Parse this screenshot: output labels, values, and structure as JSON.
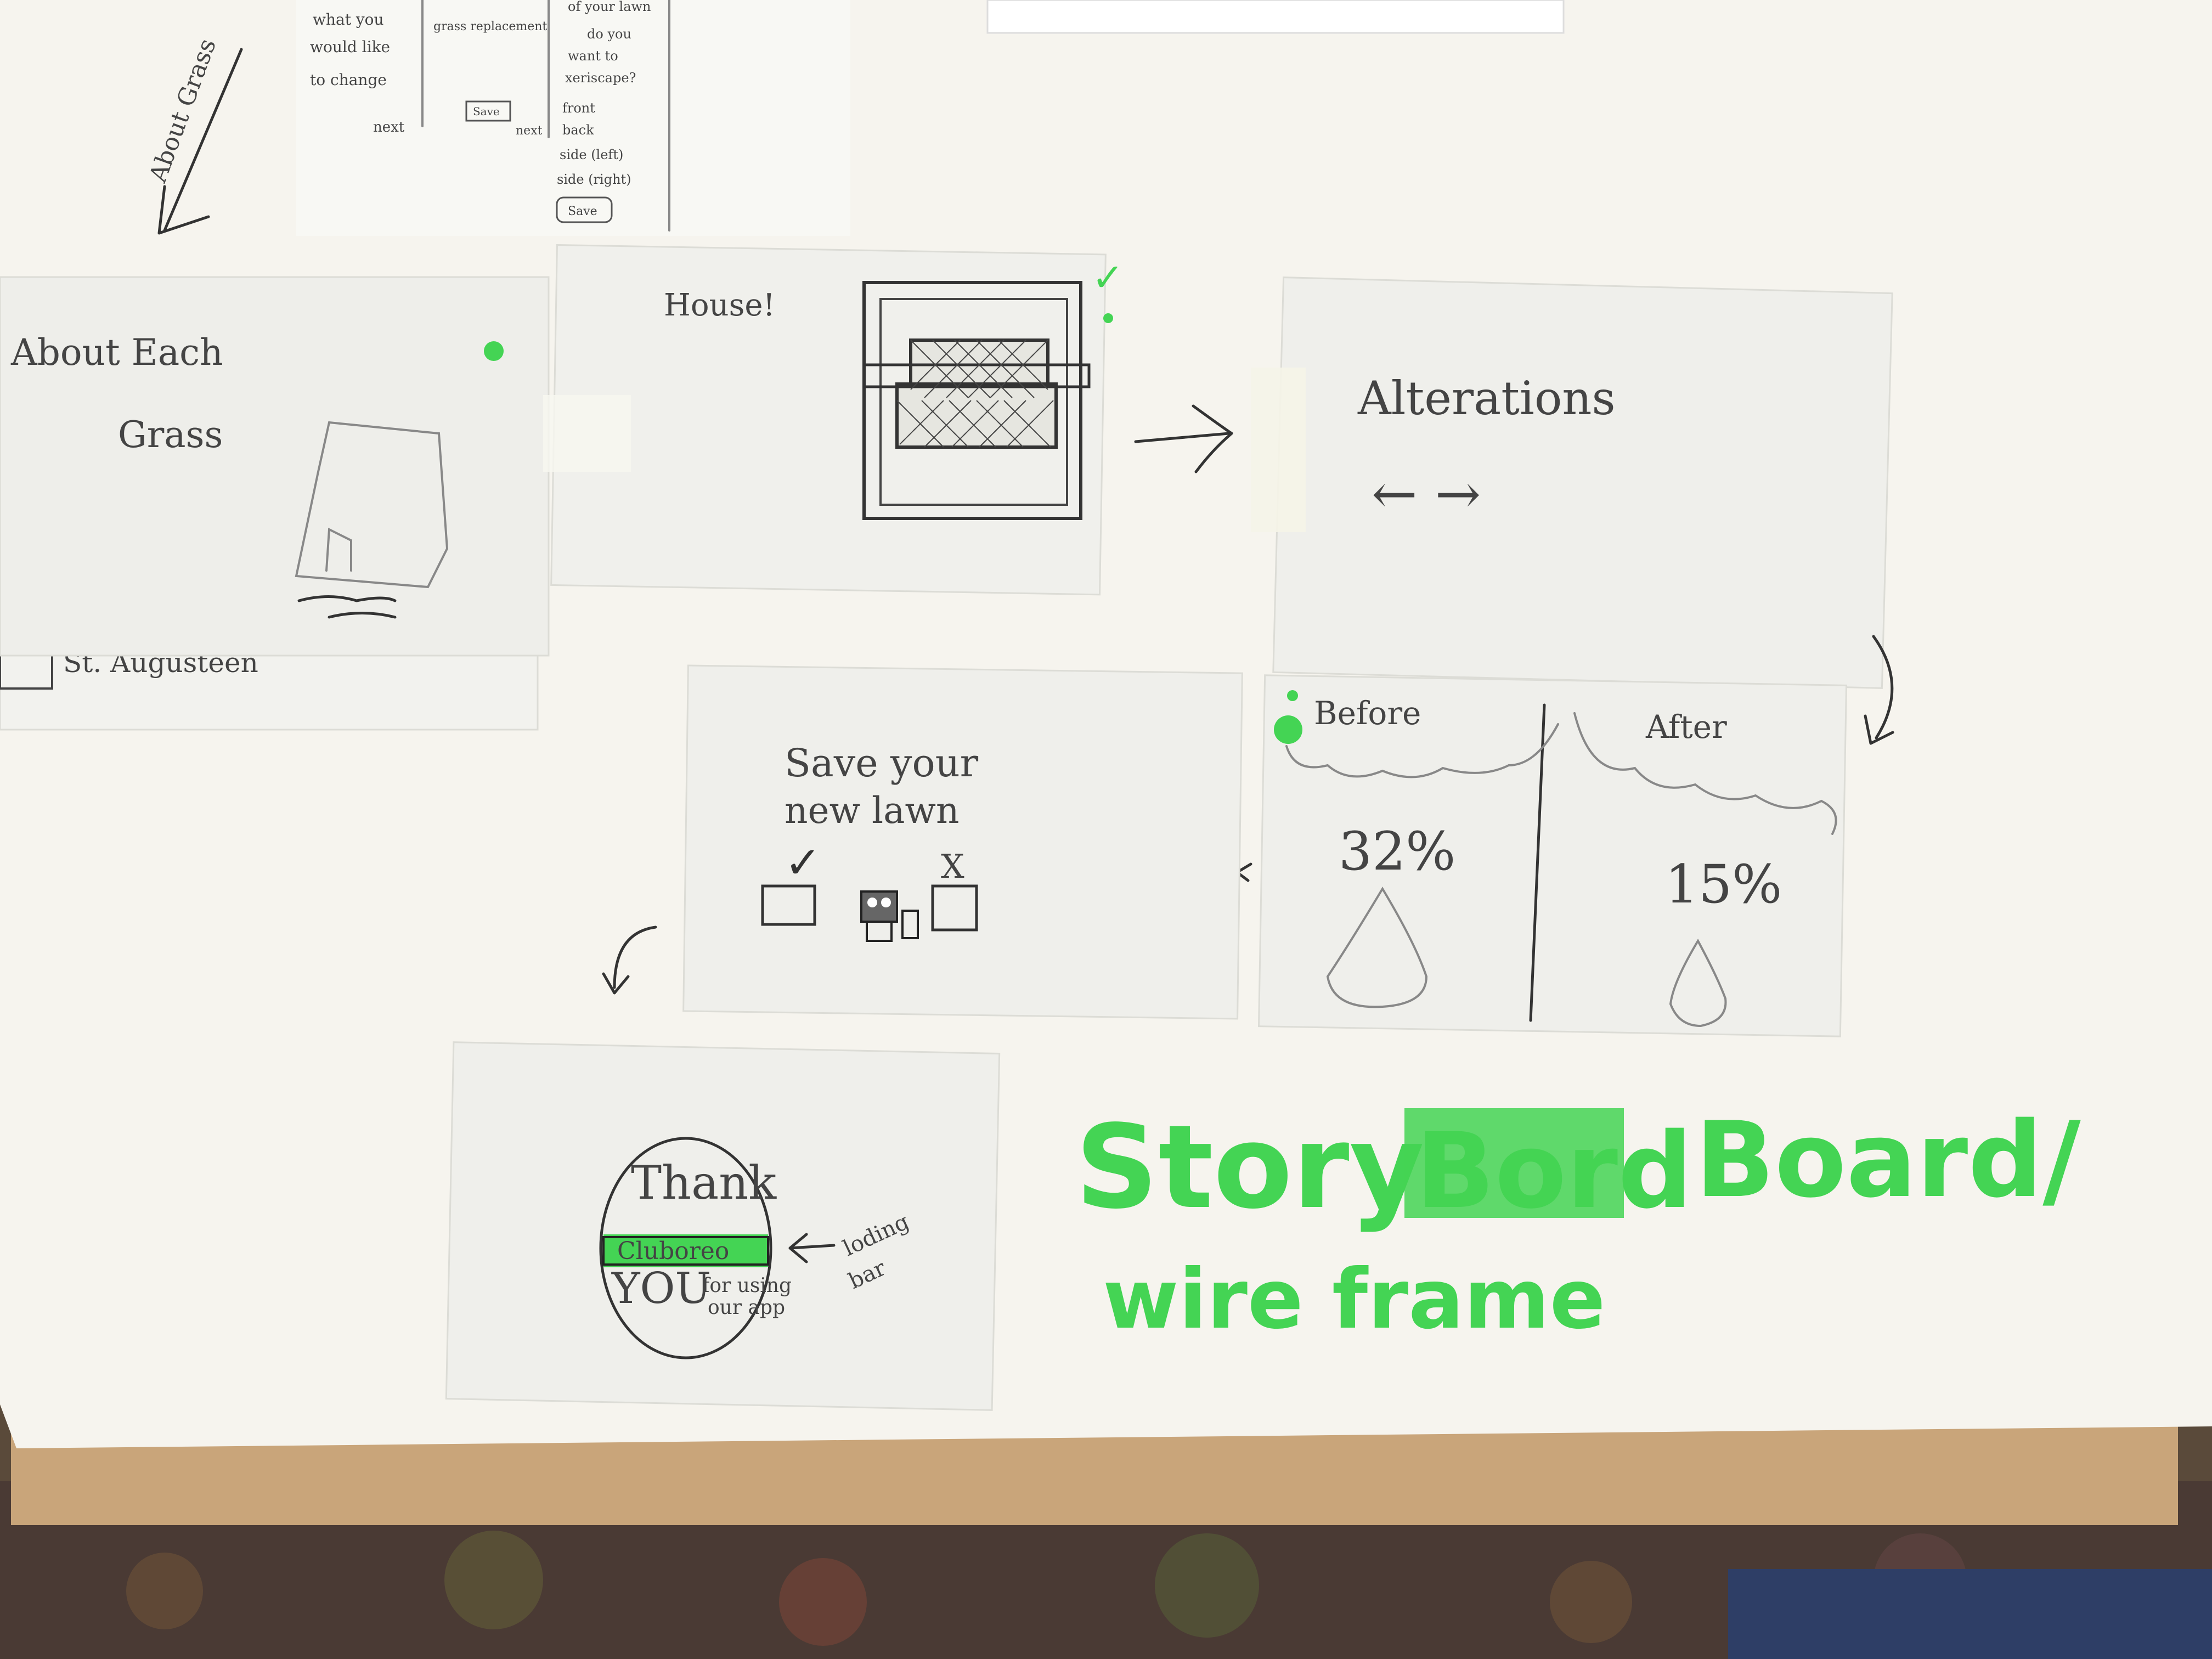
{
  "colors": {
    "poster": "#f6f4ee",
    "card": "#eeeeea",
    "ink": "#333333",
    "pencil": "#888888",
    "highlighter": "#44d454",
    "board": "#c9a57a",
    "carpet": "#4a3a34"
  },
  "top_sheet": {
    "col1": [
      "what you",
      "would like",
      "to change",
      "next"
    ],
    "col2": [
      "grass replacement",
      "Save",
      "next"
    ],
    "col3": [
      "of your lawn",
      "do you",
      "want to",
      "xeriscape?",
      "front",
      "back",
      "side (left)",
      "side (right)",
      "Save"
    ]
  },
  "about_grass_arrow_label": "About Grass",
  "card_about_grass": {
    "title_line1": "About Each",
    "title_line2": "Grass",
    "option_label": "St. Augusteen"
  },
  "card_house": {
    "label": "House!",
    "check_mark": "✓"
  },
  "card_alterations": {
    "title": "Alterations",
    "arrows": "← →"
  },
  "card_before_after": {
    "before_label": "Before",
    "after_label": "After",
    "before_value": "32%",
    "after_value": "15%"
  },
  "card_save": {
    "title_line1": "Save your",
    "title_line2": "new lawn",
    "yes_mark": "✓",
    "no_mark": "X"
  },
  "card_thank_you": {
    "line1": "Thank",
    "loading_text": "Cluboreo",
    "line3": "YOU",
    "line3_small_1": "for using",
    "line3_small_2": "our app",
    "annotation_1": "loding",
    "annotation_2": "bar"
  },
  "storyboard_title": {
    "word1": "Story",
    "struck_word": "Bord",
    "word2": "Board/",
    "line2": "wire frame"
  }
}
